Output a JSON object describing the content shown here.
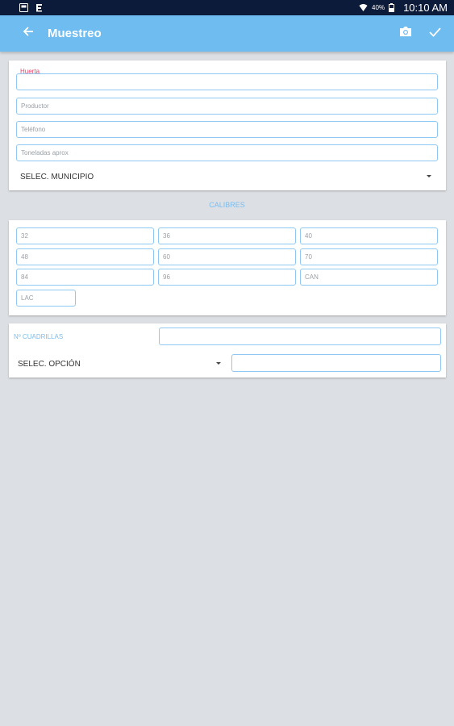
{
  "status_bar": {
    "battery_percent": "40%",
    "time": "10:10 AM"
  },
  "app_bar": {
    "title": "Muestreo",
    "icons": [
      "back-arrow-icon",
      "camera-icon",
      "check-icon"
    ]
  },
  "form": {
    "huerta": {
      "label": "Huerta",
      "value": ""
    },
    "productor": {
      "placeholder": "Productor"
    },
    "telefono": {
      "placeholder": "Teléfono"
    },
    "toneladas": {
      "placeholder": "Toneladas aprox"
    },
    "municipio_select": {
      "value": "SELEC. MUNICIPIO"
    }
  },
  "calibres": {
    "title": "CALIBRES",
    "fields": [
      "32",
      "36",
      "40",
      "48",
      "60",
      "70",
      "84",
      "96",
      "CAN",
      "LAC"
    ]
  },
  "cuadrillas": {
    "label": "Nº CUADRILLAS",
    "value": "",
    "option_select": {
      "value": "SELEC. OPCIÓN"
    },
    "option_value": ""
  },
  "colors": {
    "app_bar": "#6fbcf1",
    "status_bar": "#0d1b3a",
    "field_border": "#8ec8f3",
    "accent_label": "#e5466b"
  }
}
